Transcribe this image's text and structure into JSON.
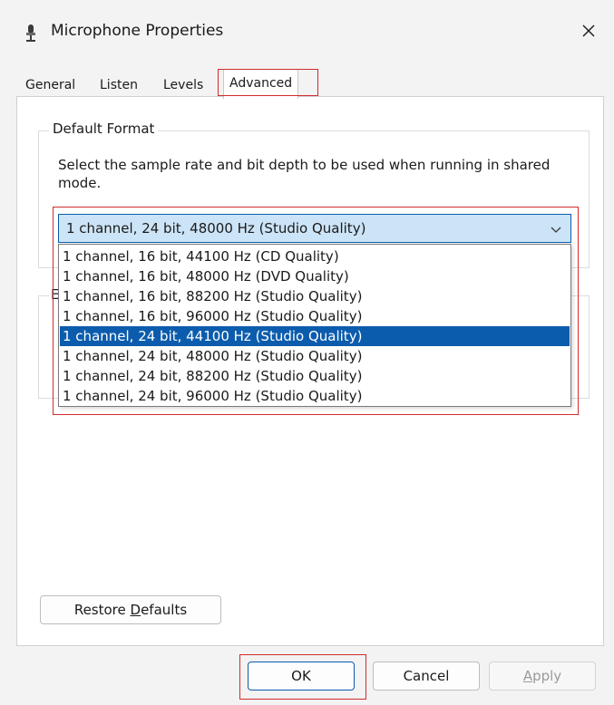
{
  "window": {
    "title": "Microphone Properties",
    "title_icon": "microphone-icon",
    "close_icon": "close-icon"
  },
  "tabs": [
    {
      "label": "General",
      "active": false
    },
    {
      "label": "Listen",
      "active": false
    },
    {
      "label": "Levels",
      "active": false
    },
    {
      "label": "Advanced",
      "active": true
    }
  ],
  "default_format": {
    "group_label": "Default Format",
    "description": "Select the sample rate and bit depth to be used when running in shared mode.",
    "selected_value": "1 channel, 24 bit, 48000 Hz (Studio Quality)",
    "chevron_icon": "chevron-down-icon",
    "options": [
      {
        "label": "1 channel, 16 bit, 44100 Hz (CD Quality)",
        "highlighted": false
      },
      {
        "label": "1 channel, 16 bit, 48000 Hz (DVD Quality)",
        "highlighted": false
      },
      {
        "label": "1 channel, 16 bit, 88200 Hz (Studio Quality)",
        "highlighted": false
      },
      {
        "label": "1 channel, 16 bit, 96000 Hz (Studio Quality)",
        "highlighted": false
      },
      {
        "label": "1 channel, 24 bit, 44100 Hz (Studio Quality)",
        "highlighted": true
      },
      {
        "label": "1 channel, 24 bit, 48000 Hz (Studio Quality)",
        "highlighted": false
      },
      {
        "label": "1 channel, 24 bit, 88200 Hz (Studio Quality)",
        "highlighted": false
      },
      {
        "label": "1 channel, 24 bit, 96000 Hz (Studio Quality)",
        "highlighted": false
      }
    ]
  },
  "exclusive_group": {
    "label_fragment": "E"
  },
  "buttons": {
    "restore_defaults_prefix": "Restore ",
    "restore_defaults_accel": "D",
    "restore_defaults_suffix": "efaults",
    "ok": "OK",
    "cancel": "Cancel",
    "apply_accel": "A",
    "apply_suffix": "pply"
  },
  "colors": {
    "accent": "#0b5cad",
    "selection_bg": "#cce4f7",
    "annotation_red": "#d12b2b"
  }
}
